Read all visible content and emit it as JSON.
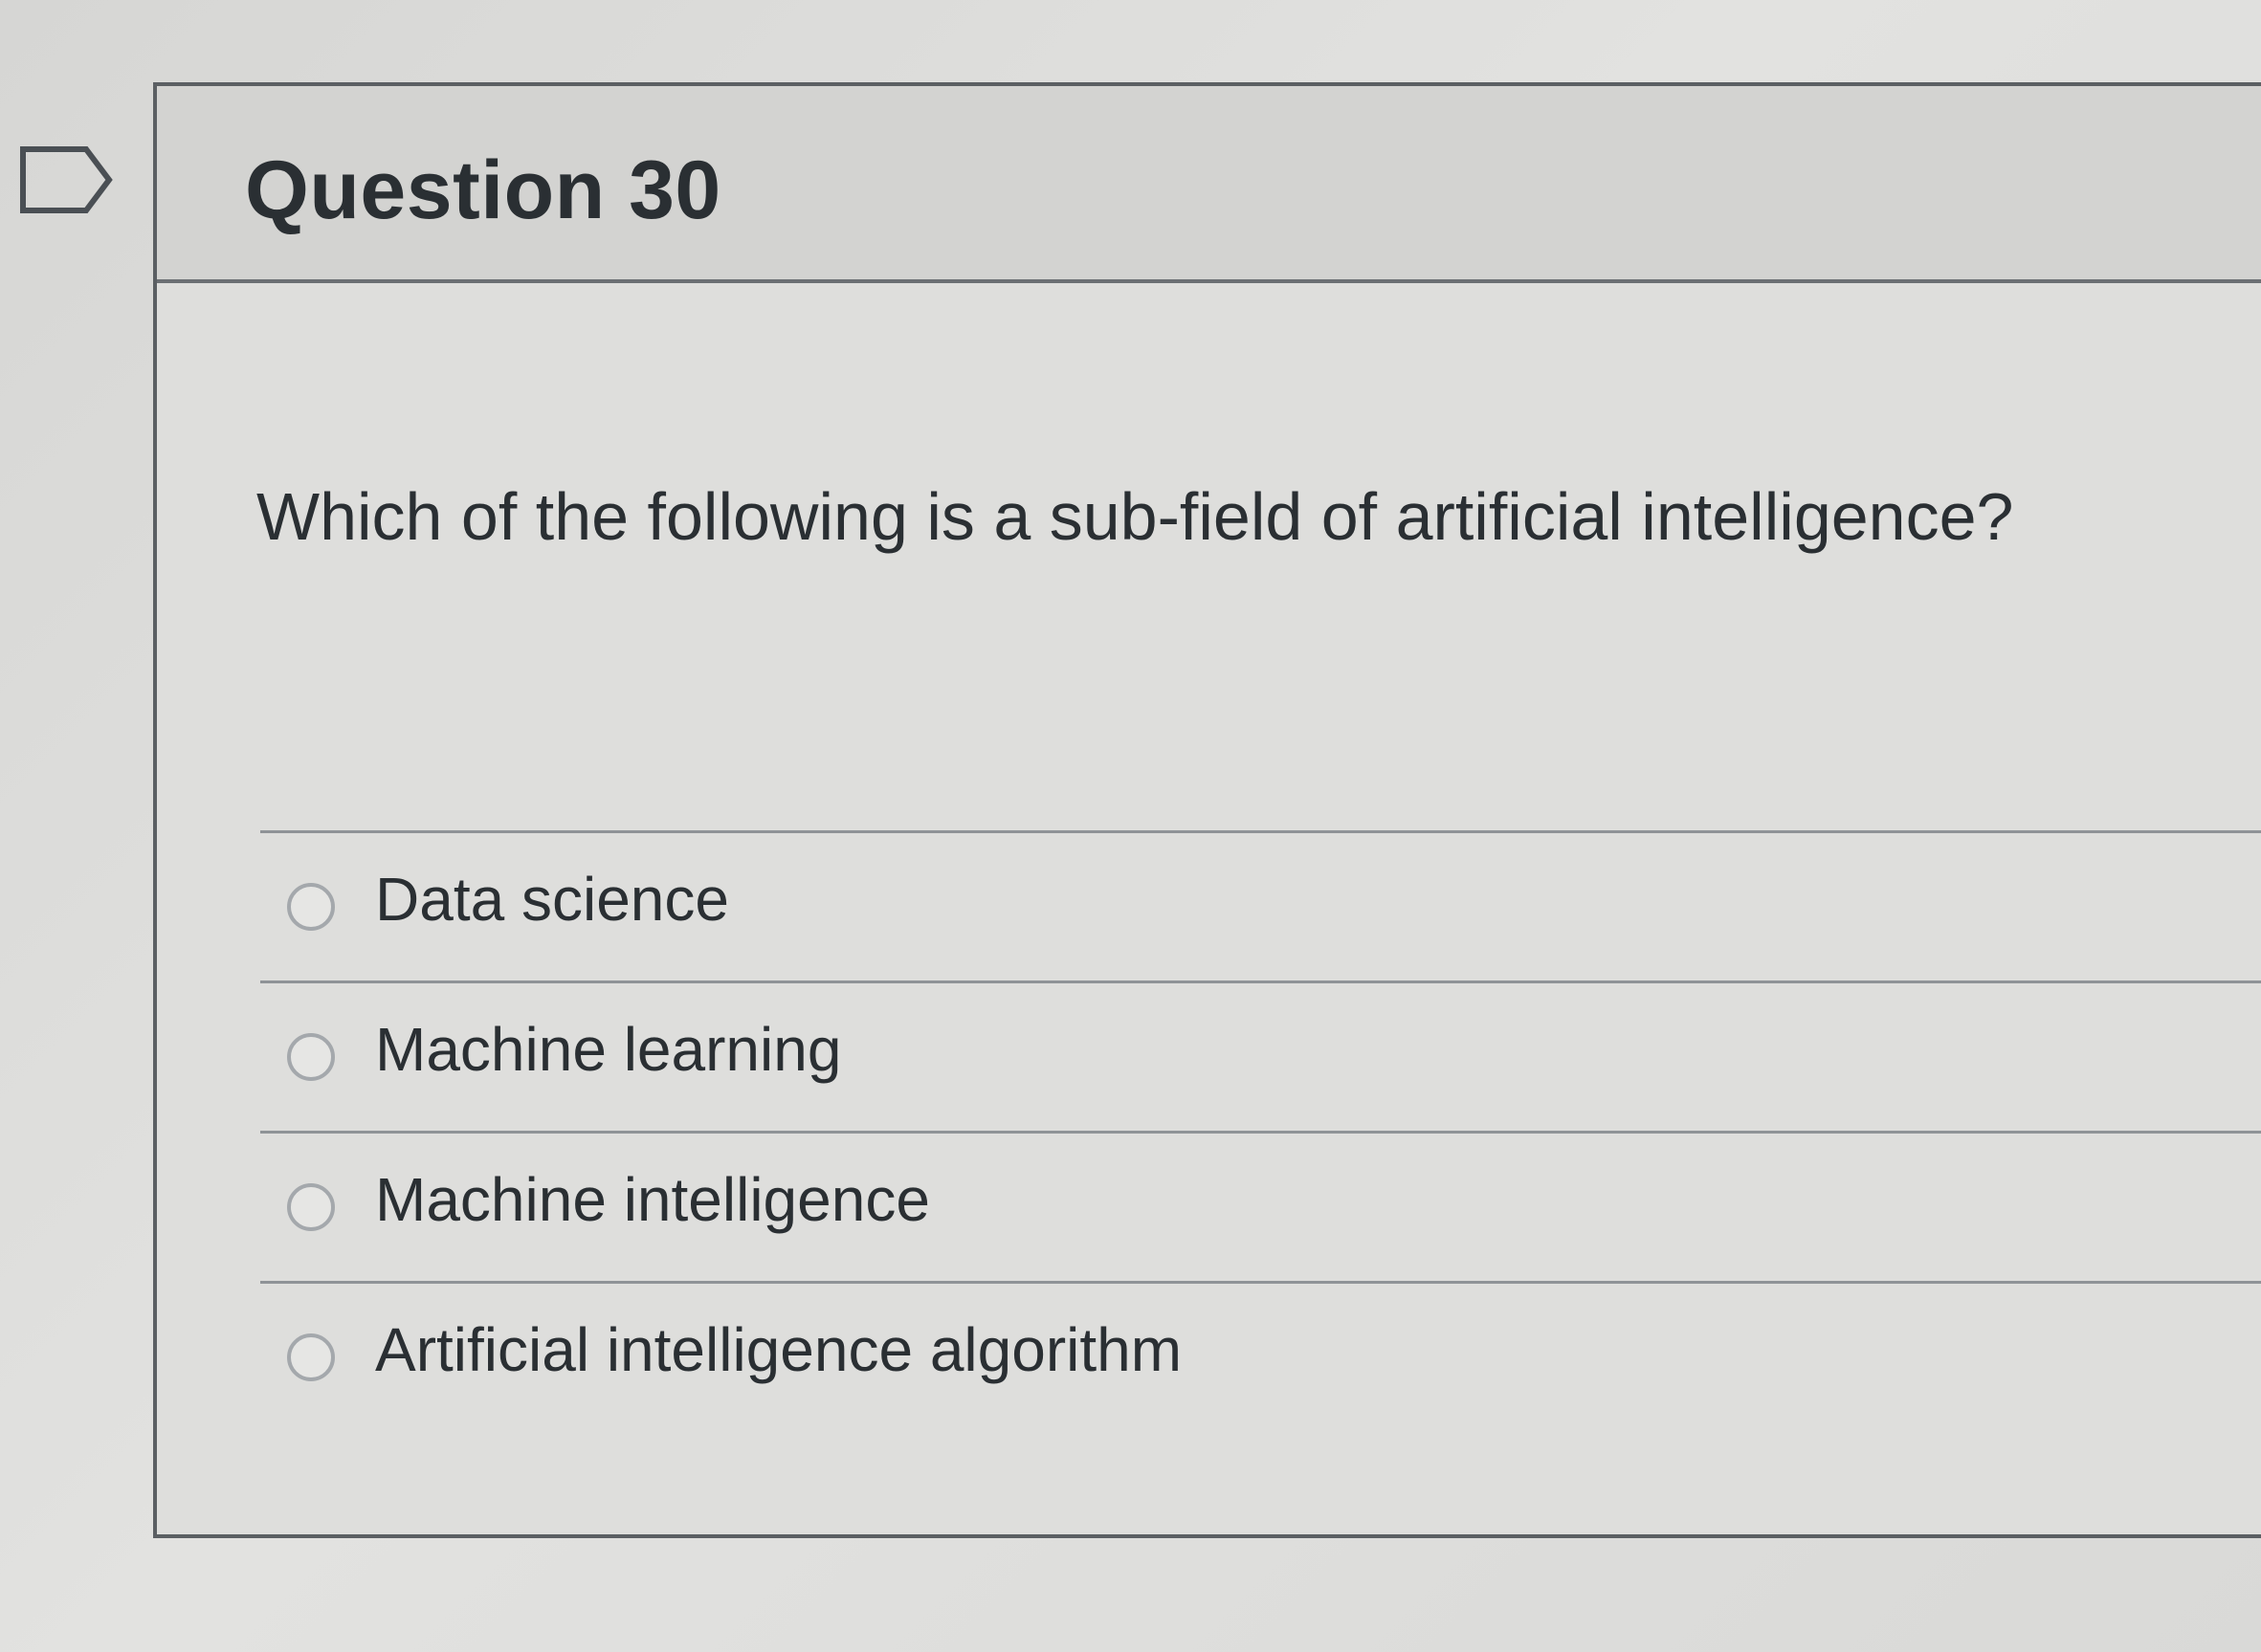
{
  "question": {
    "flag_icon": "flag-outline-icon",
    "title": "Question 30",
    "text": "Which of the following is a sub-field of artificial intelligence?",
    "answers": [
      {
        "label": "Data science",
        "selected": false
      },
      {
        "label": "Machine learning",
        "selected": false
      },
      {
        "label": "Machine intelligence",
        "selected": false
      },
      {
        "label": "Artificial intelligence algorithm",
        "selected": false
      }
    ]
  },
  "colors": {
    "text": "#2a2f33",
    "border": "#5b5f63",
    "header_bg": "#d3d3d1",
    "page_bg": "#dcdcda"
  }
}
